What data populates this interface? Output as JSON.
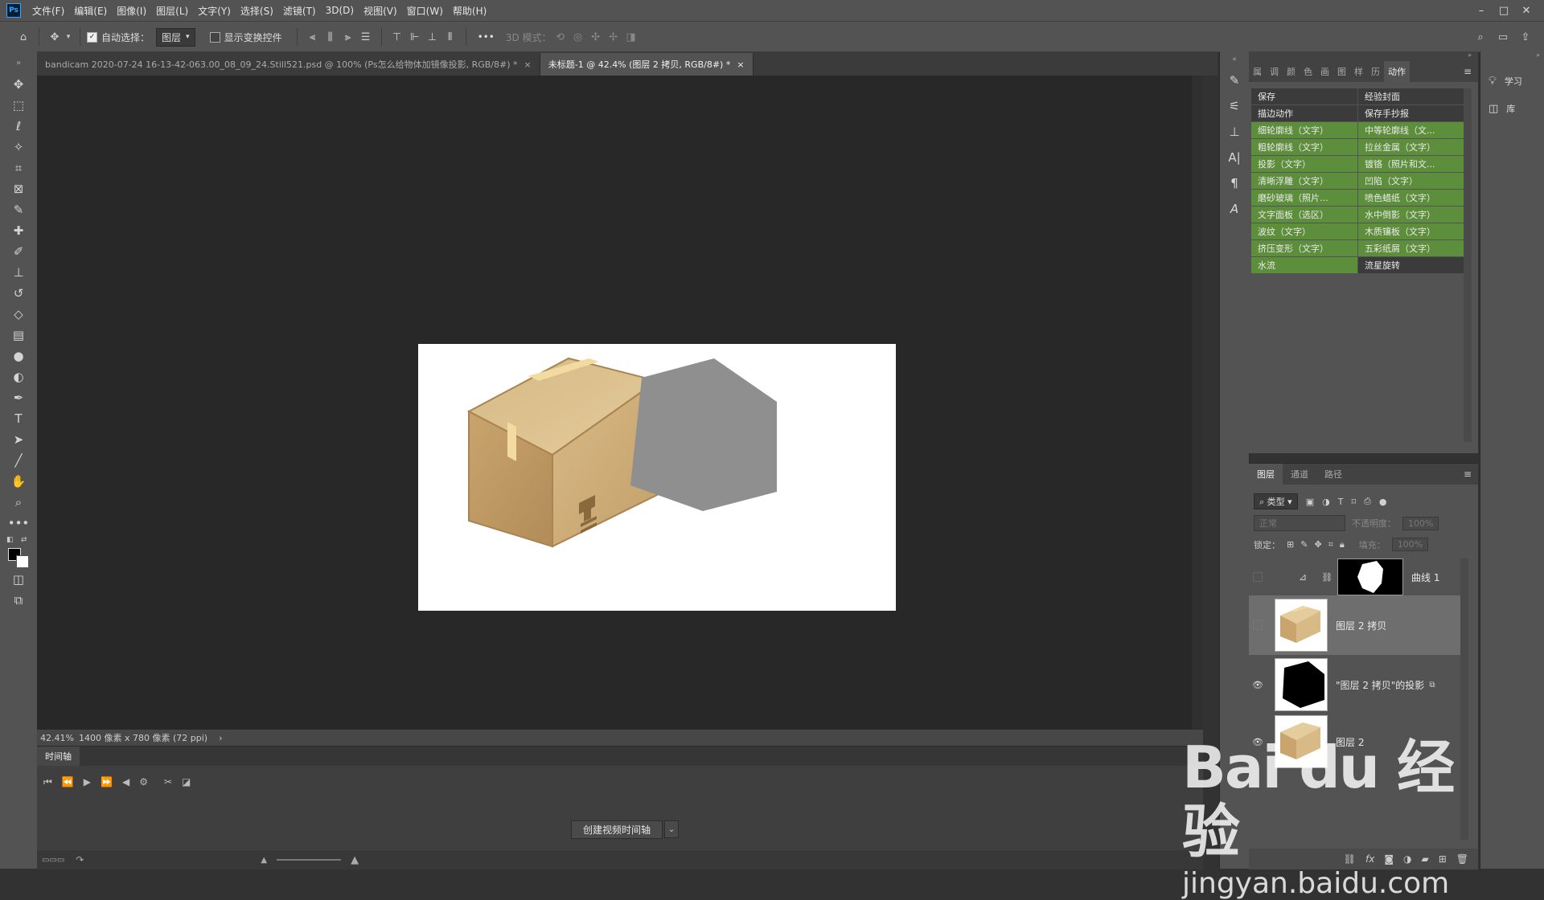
{
  "app": {
    "logo": "Ps"
  },
  "menu": [
    "文件(F)",
    "编辑(E)",
    "图像(I)",
    "图层(L)",
    "文字(Y)",
    "选择(S)",
    "滤镜(T)",
    "3D(D)",
    "视图(V)",
    "窗口(W)",
    "帮助(H)"
  ],
  "window_controls": {
    "minimize": "–",
    "maximize": "□",
    "close": "✕"
  },
  "options": {
    "auto_select_label": "自动选择：",
    "auto_select_target": "图层",
    "show_transform_label": "显示变换控件",
    "more": "•••",
    "mode_3d_label": "3D 模式："
  },
  "tabs": [
    {
      "title": "bandicam 2020-07-24 16-13-42-063.00_08_09_24.Still521.psd @ 100% (Ps怎么给物体加镜像投影, RGB/8#) *",
      "close": "×"
    },
    {
      "title": "未标题-1 @ 42.4% (图层 2 拷贝, RGB/8#) *",
      "close": "×"
    }
  ],
  "status": {
    "zoom": "42.41%",
    "doc_info": "1400 像素 x 780 像素 (72 ppi)",
    "arrow": "›"
  },
  "timeline": {
    "tab": "时间轴",
    "create_button": "创建视频时间轴",
    "dropdown": "⌄"
  },
  "actions_panel": {
    "tabs": [
      "属",
      "调",
      "颜",
      "色",
      "画",
      "图",
      "样",
      "历",
      "动作"
    ],
    "menu_icon": "≡",
    "buttons": [
      {
        "label": "保存",
        "color": "gray"
      },
      {
        "label": "经验封面",
        "color": "gray"
      },
      {
        "label": "描边动作",
        "color": "gray"
      },
      {
        "label": "保存手抄报",
        "color": "gray"
      },
      {
        "label": "细轮廓线（文字）",
        "color": "green"
      },
      {
        "label": "中等轮廓线（文...",
        "color": "green"
      },
      {
        "label": "粗轮廓线（文字）",
        "color": "green"
      },
      {
        "label": "拉丝金属（文字）",
        "color": "green"
      },
      {
        "label": "投影（文字）",
        "color": "green"
      },
      {
        "label": "镀铬（照片和文...",
        "color": "green"
      },
      {
        "label": "清晰浮雕（文字）",
        "color": "green"
      },
      {
        "label": "凹陷（文字）",
        "color": "green"
      },
      {
        "label": "磨砂玻璃（照片...",
        "color": "green"
      },
      {
        "label": "喷色蜡纸（文字）",
        "color": "green"
      },
      {
        "label": "文字面板（选区）",
        "color": "green"
      },
      {
        "label": "水中倒影（文字）",
        "color": "green"
      },
      {
        "label": "波纹（文字）",
        "color": "green"
      },
      {
        "label": "木质镶板（文字）",
        "color": "green"
      },
      {
        "label": "挤压变形（文字）",
        "color": "green"
      },
      {
        "label": "五彩纸屑（文字）",
        "color": "green"
      },
      {
        "label": "水流",
        "color": "green"
      },
      {
        "label": "流星旋转",
        "color": "gray"
      }
    ]
  },
  "layers_panel": {
    "tabs": [
      "图层",
      "通道",
      "路径"
    ],
    "menu_icon": "≡",
    "filter_label": "类型",
    "blend_mode": "正常",
    "opacity_label": "不透明度：",
    "opacity_value": "100%",
    "lock_label": "锁定：",
    "fill_label": "填充：",
    "fill_value": "100%",
    "layers": [
      {
        "name": "曲线 1",
        "visible": false
      },
      {
        "name": "图层 2 拷贝",
        "visible": false,
        "selected": true
      },
      {
        "name": "\"图层 2 拷贝\"的投影",
        "visible": true
      },
      {
        "name": "图层 2",
        "visible": true
      }
    ]
  },
  "right_panel": {
    "learn": "学习",
    "library": "库"
  },
  "watermark": {
    "logo": "Bai du 经验",
    "url": "jingyan.baidu.com"
  },
  "colors": {
    "box_tan": "#c9a46d",
    "box_dark": "#a98452",
    "box_light": "#dcc08c",
    "tape": "#f1dba0",
    "shadow": "#8f8f8f",
    "action_green": "#5d8e3b"
  }
}
